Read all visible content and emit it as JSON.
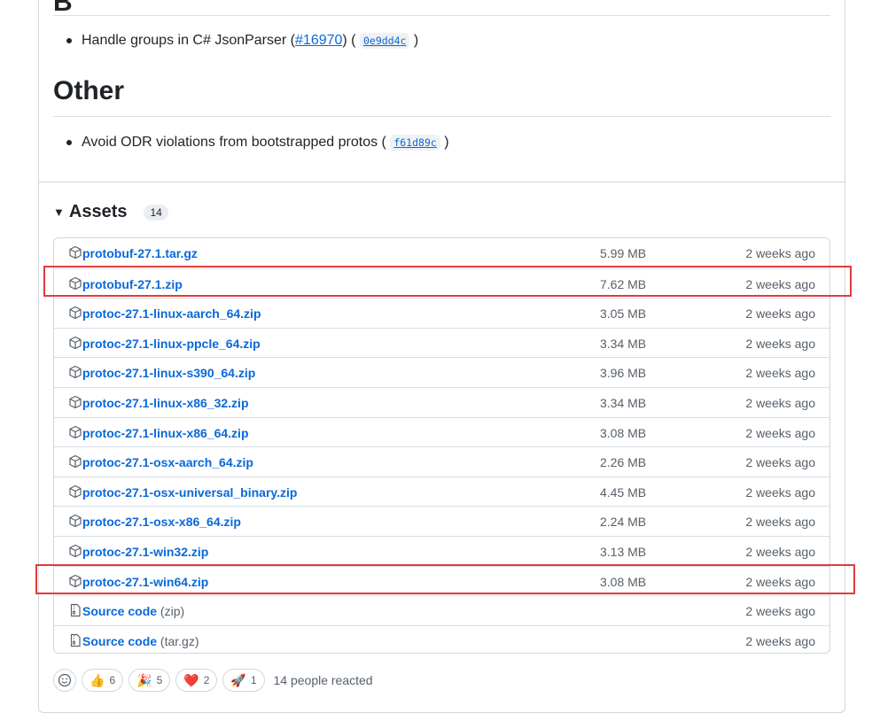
{
  "top_section": {
    "heading_partial": "B",
    "item": {
      "text_before": "Handle groups in C# JsonParser (",
      "link": "#16970",
      "text_mid": ") (",
      "commit": "0e9dd4c",
      "text_after": ")"
    }
  },
  "other_section": {
    "heading": "Other",
    "item": {
      "text_before": "Avoid ODR violations from bootstrapped protos (",
      "commit": "f61d89c",
      "text_after": ")"
    }
  },
  "assets": {
    "title": "Assets",
    "count": "14",
    "rows": [
      {
        "name": "protobuf-27.1.tar.gz",
        "ext": "",
        "size": "5.99 MB",
        "date": "2 weeks ago",
        "icon": "package-icon"
      },
      {
        "name": "protobuf-27.1.zip",
        "ext": "",
        "size": "7.62 MB",
        "date": "2 weeks ago",
        "icon": "package-icon"
      },
      {
        "name": "protoc-27.1-linux-aarch_64.zip",
        "ext": "",
        "size": "3.05 MB",
        "date": "2 weeks ago",
        "icon": "package-icon"
      },
      {
        "name": "protoc-27.1-linux-ppcle_64.zip",
        "ext": "",
        "size": "3.34 MB",
        "date": "2 weeks ago",
        "icon": "package-icon"
      },
      {
        "name": "protoc-27.1-linux-s390_64.zip",
        "ext": "",
        "size": "3.96 MB",
        "date": "2 weeks ago",
        "icon": "package-icon"
      },
      {
        "name": "protoc-27.1-linux-x86_32.zip",
        "ext": "",
        "size": "3.34 MB",
        "date": "2 weeks ago",
        "icon": "package-icon"
      },
      {
        "name": "protoc-27.1-linux-x86_64.zip",
        "ext": "",
        "size": "3.08 MB",
        "date": "2 weeks ago",
        "icon": "package-icon"
      },
      {
        "name": "protoc-27.1-osx-aarch_64.zip",
        "ext": "",
        "size": "2.26 MB",
        "date": "2 weeks ago",
        "icon": "package-icon"
      },
      {
        "name": "protoc-27.1-osx-universal_binary.zip",
        "ext": "",
        "size": "4.45 MB",
        "date": "2 weeks ago",
        "icon": "package-icon"
      },
      {
        "name": "protoc-27.1-osx-x86_64.zip",
        "ext": "",
        "size": "2.24 MB",
        "date": "2 weeks ago",
        "icon": "package-icon"
      },
      {
        "name": "protoc-27.1-win32.zip",
        "ext": "",
        "size": "3.13 MB",
        "date": "2 weeks ago",
        "icon": "package-icon"
      },
      {
        "name": "protoc-27.1-win64.zip",
        "ext": "",
        "size": "3.08 MB",
        "date": "2 weeks ago",
        "icon": "package-icon"
      },
      {
        "name": "Source code",
        "ext": "(zip)",
        "size": "",
        "date": "2 weeks ago",
        "icon": "file-zip-icon"
      },
      {
        "name": "Source code",
        "ext": "(tar.gz)",
        "size": "",
        "date": "2 weeks ago",
        "icon": "file-zip-icon"
      }
    ]
  },
  "reactions": {
    "items": [
      {
        "emoji": "👍",
        "count": "6",
        "name": "thumbs-up"
      },
      {
        "emoji": "🎉",
        "count": "5",
        "name": "hooray"
      },
      {
        "emoji": "❤️",
        "count": "2",
        "name": "heart"
      },
      {
        "emoji": "🚀",
        "count": "1",
        "name": "rocket"
      }
    ],
    "summary": "14 people reacted"
  },
  "colors": {
    "link": "#0969da",
    "highlight": "#e03c3c",
    "muted": "#57606a",
    "border": "#d0d7de"
  }
}
